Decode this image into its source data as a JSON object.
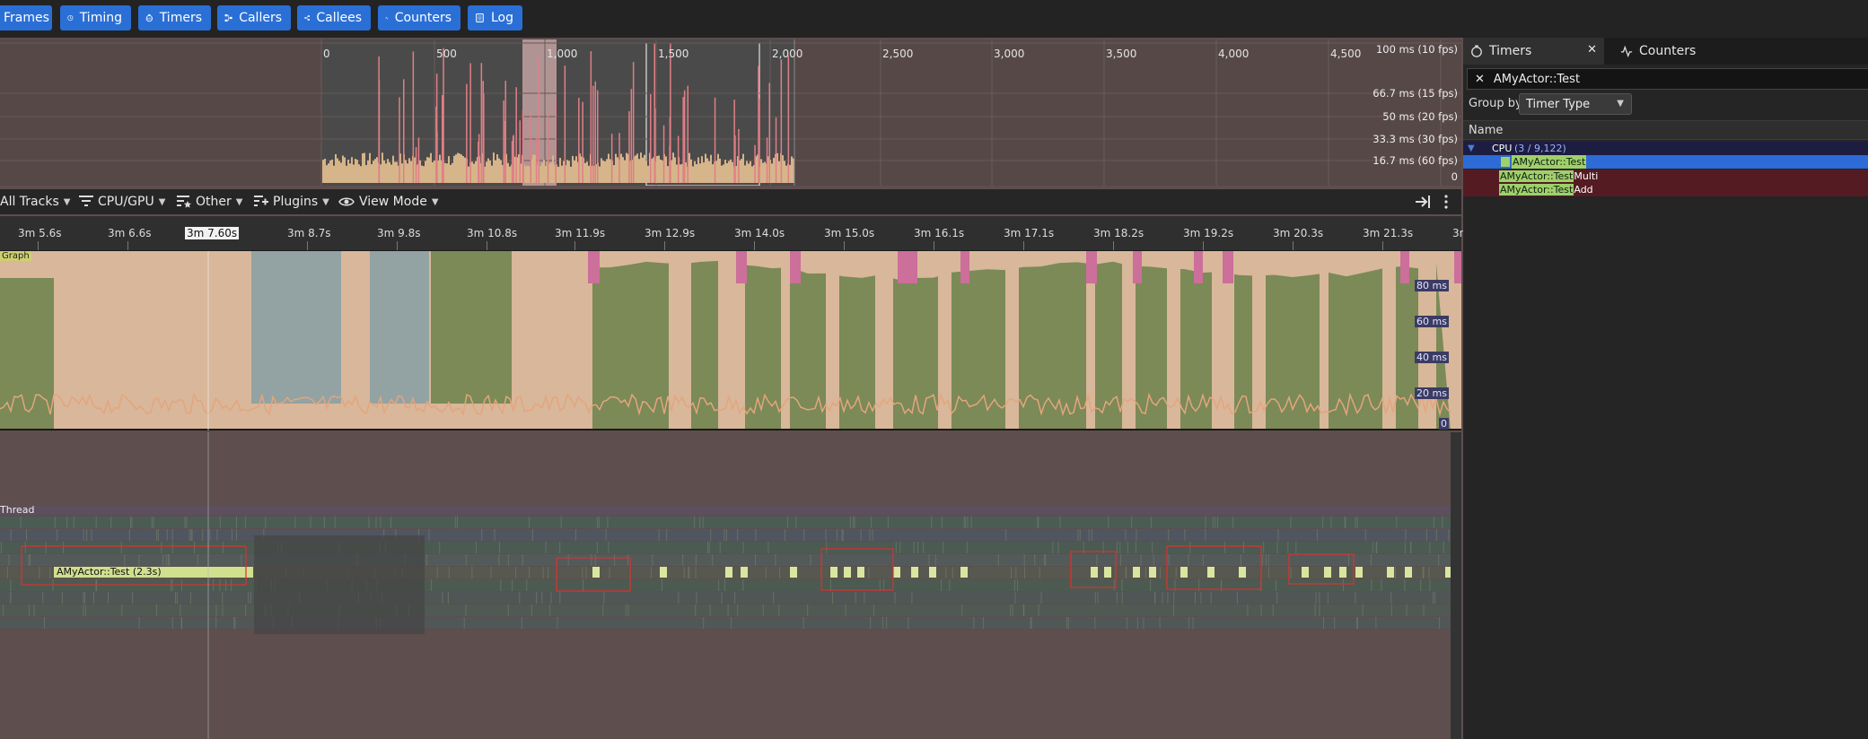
{
  "toolbar": {
    "buttons": [
      {
        "label": "Frames",
        "icon": "frames-icon"
      },
      {
        "label": "Timing",
        "icon": "timing-icon"
      },
      {
        "label": "Timers",
        "icon": "timers-icon"
      },
      {
        "label": "Callers",
        "icon": "callers-icon"
      },
      {
        "label": "Callees",
        "icon": "callees-icon"
      },
      {
        "label": "Counters",
        "icon": "counters-icon"
      },
      {
        "label": "Log",
        "icon": "log-icon"
      }
    ]
  },
  "frames_panel": {
    "ticks": [
      "0",
      "500",
      "1,000",
      "1,500",
      "2,000",
      "2,500",
      "3,000",
      "3,500",
      "4,000",
      "4,500"
    ],
    "ms_labels": [
      "100 ms (10 fps)",
      "66.7 ms (15 fps)",
      "50 ms (20 fps)",
      "33.3 ms (30 fps)",
      "16.7 ms (60 fps)",
      "0"
    ]
  },
  "timing_toolbar": {
    "all_tracks": "All Tracks",
    "cpu_gpu": "CPU/GPU",
    "other": "Other",
    "plugins": "Plugins",
    "view_mode": "View Mode"
  },
  "ruler": {
    "ticks": [
      "3m 5.6s",
      "3m 6.6s",
      "3m 8.7s",
      "3m 9.8s",
      "3m 10.8s",
      "3m 11.9s",
      "3m 12.9s",
      "3m 14.0s",
      "3m 15.0s",
      "3m 16.1s",
      "3m 17.1s",
      "3m 18.2s",
      "3m 19.2s",
      "3m 20.3s",
      "3m 21.3s",
      "3n"
    ],
    "cursor_time": "3m 7.60s"
  },
  "graph": {
    "label": "Graph",
    "ms_labels": [
      "80 ms",
      "60 ms",
      "40 ms",
      "20 ms",
      "0"
    ]
  },
  "tracks": {
    "thread_label": "Thread",
    "event_label": "AMyActor::Test (2.3s)",
    "small_labels": [
      "A",
      "A",
      "A",
      "A",
      "A",
      "A",
      "A",
      "A",
      "A",
      "A",
      "A",
      "A",
      "A",
      "A"
    ]
  },
  "right_panel": {
    "tab_timers": "Timers",
    "tab_counters": "Counters",
    "search_value": "AMyActor::Test",
    "group_by_label": "Group by",
    "group_by_value": "Timer Type",
    "column_name": "Name",
    "cpu_label": "CPU",
    "cpu_count": "(3 / 9,122)",
    "rows": [
      {
        "match": "AMyActor::Test",
        "rest": ""
      },
      {
        "match": "AMyActor::Test",
        "rest": "Multi"
      },
      {
        "match": "AMyActor::Test",
        "rest": "Add"
      }
    ]
  },
  "colors": {
    "accent_blue": "#2a6fd6",
    "graph_green": "#7a8a55",
    "graph_peach": "#d9b79a",
    "highlight_pink": "#cc6f9a",
    "selection_red": "#e0302f",
    "match_green": "#9fd06a"
  }
}
